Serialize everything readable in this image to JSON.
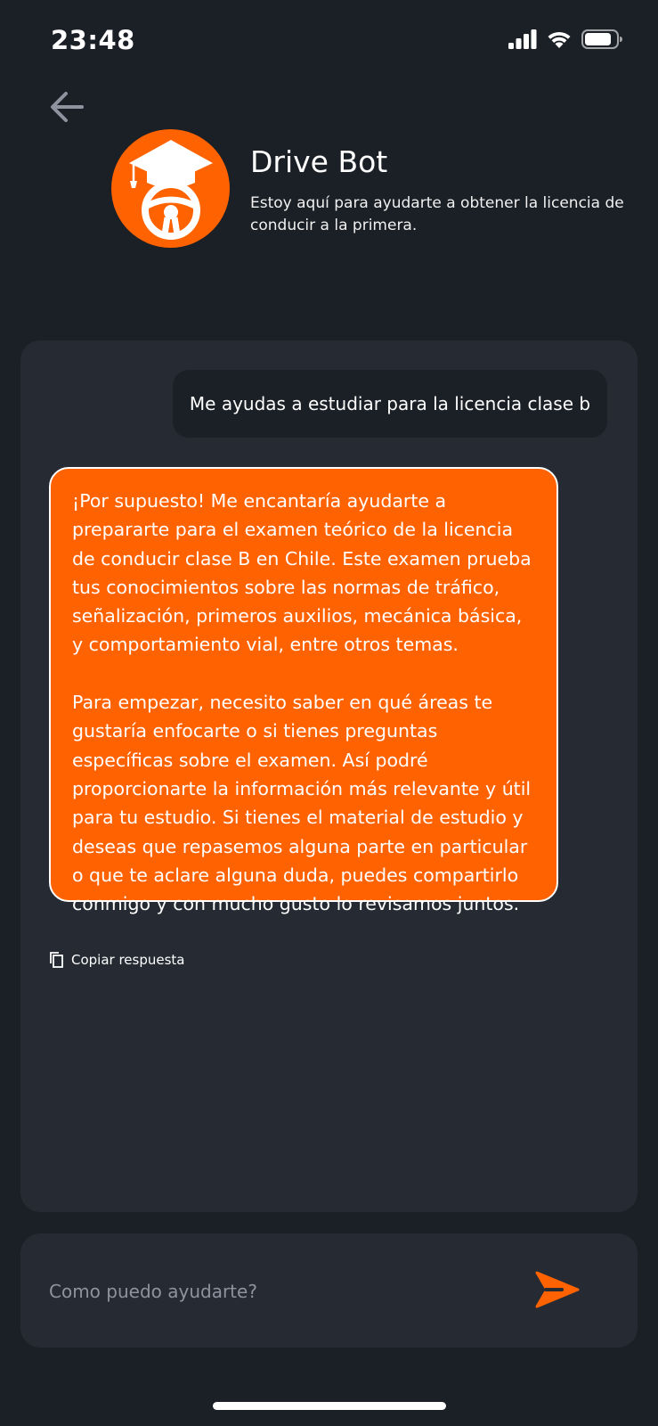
{
  "status_bar": {
    "time": "23:48",
    "icons": [
      "signal-icon",
      "wifi-icon",
      "battery-icon"
    ]
  },
  "header": {
    "back_icon": "arrow-left-icon",
    "bot_name": "Drive Bot",
    "bot_description": "Estoy aquí para ayudarte a obtener la licencia de conducir a la primera.",
    "avatar_icon": "graduation-cap-steering-wheel-icon"
  },
  "chat": {
    "user_message": "Me ayudas a estudiar para la licencia clase b",
    "bot_paragraph_1": "¡Por supuesto! Me encantaría ayudarte a prepararte para el examen teórico de la licencia de conducir clase B en Chile. Este examen prueba tus conocimientos sobre las normas de tráfico, señalización, primeros auxilios, mecánica básica, y comportamiento vial, entre otros temas.",
    "bot_paragraph_2": "Para empezar, necesito saber en qué áreas te gustaría enfocarte o si tienes preguntas específicas sobre el examen. Así podré proporcionarte la información más relevante y útil para tu estudio. Si tienes el material de estudio y deseas que repasemos alguna parte en particular o que te aclare alguna duda, puedes compartirlo conmigo y con mucho gusto lo revisamos juntos.",
    "copy_label": "Copiar respuesta"
  },
  "input": {
    "placeholder": "Como puedo ayudarte?",
    "value": ""
  },
  "colors": {
    "background": "#1b1f26",
    "panel": "#252a33",
    "accent": "#ff6200",
    "placeholder": "#8d949e"
  }
}
